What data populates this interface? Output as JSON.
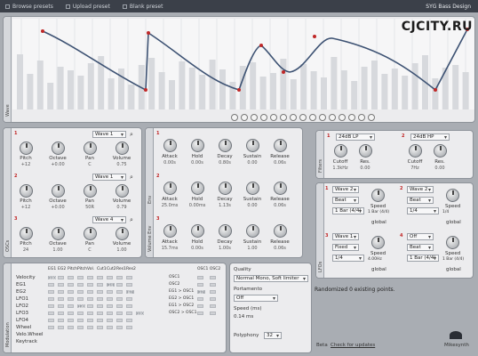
{
  "topbar": {
    "browse_label": "Browse presets",
    "upload_label": "Upload preset",
    "blank_label": "Blank preset",
    "preset_name": "SYG Bass Design"
  },
  "watermark": "CJCITY.RU",
  "wave_panel": {
    "label": "Wave",
    "toolbar_icons": [
      "zoom-out-icon",
      "zoom-in-icon",
      "line-icon",
      "curve-icon",
      "step-icon",
      "half-icon",
      "grid-icon",
      "sine-icon",
      "square-icon",
      "triangle-icon",
      "saw-icon",
      "noise-icon",
      "random-icon",
      "flip-icon",
      "mirror-icon"
    ],
    "random_points": "Randomized 0 existing points."
  },
  "osc_panel": {
    "label": "OSCs",
    "oscs": [
      {
        "num": "1",
        "wave": "Wave 1",
        "knobs": [
          {
            "label": "Pitch",
            "value": "+12"
          },
          {
            "label": "Octave",
            "value": "+0.00"
          },
          {
            "label": "Pan",
            "value": "C"
          },
          {
            "label": "Volume",
            "value": "0.75"
          }
        ]
      },
      {
        "num": "2",
        "wave": "Wave 1",
        "knobs": [
          {
            "label": "Pitch",
            "value": "+12"
          },
          {
            "label": "Octave",
            "value": "+0.00"
          },
          {
            "label": "Pan",
            "value": "50R"
          },
          {
            "label": "Volume",
            "value": "0.79"
          }
        ]
      },
      {
        "num": "3",
        "wave": "Wave 4",
        "knobs": [
          {
            "label": "Pitch",
            "value": "24"
          },
          {
            "label": "Octave",
            "value": "1.00"
          },
          {
            "label": "Pan",
            "value": "C"
          },
          {
            "label": "Volume",
            "value": "1.00"
          }
        ]
      }
    ]
  },
  "env_panel": {
    "env_label": "Env",
    "volume_label": "Volume Env",
    "envs": [
      {
        "num": "1",
        "knobs": [
          {
            "label": "Attack",
            "value": "0.00s"
          },
          {
            "label": "Hold",
            "value": "0.00s"
          },
          {
            "label": "Decay",
            "value": "0.80s"
          },
          {
            "label": "Sustain",
            "value": "0.00"
          },
          {
            "label": "Release",
            "value": "0.06s"
          }
        ]
      },
      {
        "num": "2",
        "knobs": [
          {
            "label": "Attack",
            "value": "25.0ms"
          },
          {
            "label": "Hold",
            "value": "0.00ms"
          },
          {
            "label": "Decay",
            "value": "1.13s"
          },
          {
            "label": "Sustain",
            "value": "0.00"
          },
          {
            "label": "Release",
            "value": "0.06s"
          }
        ]
      },
      {
        "num": "3",
        "knobs": [
          {
            "label": "Attack",
            "value": "15.7ms"
          },
          {
            "label": "Hold",
            "value": "0.00s"
          },
          {
            "label": "Decay",
            "value": "1.00s"
          },
          {
            "label": "Sustain",
            "value": "1.00"
          },
          {
            "label": "Release",
            "value": "0.06s"
          }
        ]
      }
    ]
  },
  "filter_panel": {
    "label": "Filters",
    "filters": [
      {
        "num": "1",
        "type": "24dB LP",
        "knobs": [
          {
            "label": "Cutoff",
            "value": "1.3kHz"
          },
          {
            "label": "Res.",
            "value": "0.00"
          }
        ]
      },
      {
        "num": "2",
        "type": "24dB HP",
        "knobs": [
          {
            "label": "Cutoff",
            "value": "7Hz"
          },
          {
            "label": "Res.",
            "value": "0.00"
          }
        ]
      }
    ]
  },
  "lfo_panel": {
    "label": "LFOs",
    "lfos": [
      {
        "num": "1",
        "wave": "Wave 2",
        "mode": "Beat",
        "rate": "1 Bar (4/4)",
        "speed_label": "Speed",
        "speed_value": "1 Bar (4/4)",
        "reset": "global"
      },
      {
        "num": "2",
        "wave": "Wave 2",
        "mode": "Beat",
        "rate": "1/4",
        "speed_label": "Speed",
        "speed_value": "1/4",
        "reset": "global"
      },
      {
        "num": "3",
        "wave": "Wave 1",
        "mode": "Fixed",
        "rate": "1/4",
        "speed_label": "Speed",
        "speed_value": "4.00Hz",
        "reset": "global"
      },
      {
        "num": "4",
        "wave": "Off",
        "mode": "Beat",
        "rate": "1 Bar (4/4)",
        "speed_label": "Speed",
        "speed_value": "1 Bar (4/4)",
        "reset": "global"
      }
    ]
  },
  "mod_panel": {
    "label": "Modulation",
    "col_headers": [
      "EG1",
      "EG2",
      "Pitch",
      "Pitch",
      "Vol.",
      "Cut1",
      "Cut2",
      "Res1",
      "Res2"
    ],
    "row_labels": [
      "Velocity",
      "EG1",
      "EG2",
      "LFO1",
      "LFO2",
      "LFO3",
      "LFO4",
      "Wheel",
      "Velo.Wheel",
      "Keytrack"
    ],
    "values": [
      "100",
      "130",
      "24",
      "87",
      "100"
    ],
    "osc_header": "OSC1 OSC2",
    "osc_rows": [
      "OSC1",
      "OSC2",
      "EG1 > OSC1",
      "EG2 > OSC1",
      "EG1 > OSC2",
      "OSC2 > OSC1"
    ],
    "osc_values": [
      "37"
    ]
  },
  "quality_panel": {
    "quality_label": "Quality",
    "quality_value": "Normal Mono, Soft limiter",
    "portamento_label": "Portamento",
    "portamento_value": "Off",
    "speed_label": "Speed (ms)",
    "speed_value": "0.14 ms",
    "polyphony_label": "Polyphony",
    "polyphony_value": "32"
  },
  "footer": {
    "version": "Beta",
    "updates_link": "Check for updates",
    "brand": "Mikesynth"
  }
}
